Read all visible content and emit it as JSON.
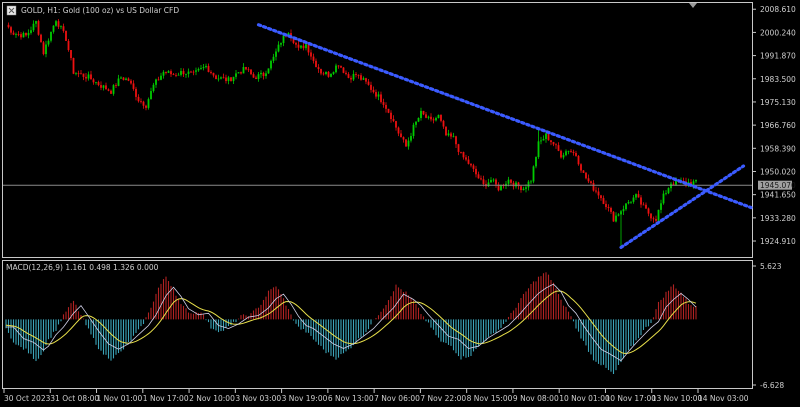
{
  "chart_data": {
    "type": "candlestick",
    "title": "GOLD, H1:  Gold (100 oz) vs US Dollar CFD",
    "price_axis": {
      "ticks": [
        "2008.610",
        "2000.240",
        "1991.870",
        "1983.500",
        "1975.130",
        "1966.760",
        "1958.390",
        "1950.020",
        "1941.650",
        "1933.280",
        "1924.910"
      ],
      "tick_values": [
        2008.61,
        2000.24,
        1991.87,
        1983.5,
        1975.13,
        1966.76,
        1958.39,
        1950.02,
        1941.65,
        1933.28,
        1924.91
      ],
      "range": [
        1919.5,
        2010.5
      ]
    },
    "current_price": {
      "label": "1945.070",
      "value": 1945.07
    },
    "time_labels": [
      "30 Oct 2023",
      "31 Oct 08:00",
      "1 Nov 01:00",
      "1 Nov 17:00",
      "2 Nov 10:00",
      "3 Nov 03:00",
      "3 Nov 19:00",
      "6 Nov 13:00",
      "7 Nov 06:00",
      "7 Nov 22:00",
      "8 Nov 15:00",
      "9 Nov 08:00",
      "10 Nov 01:00",
      "10 Nov 17:00",
      "13 Nov 10:00",
      "14 Nov 03:00"
    ],
    "close_anchors": [
      [
        0,
        2003
      ],
      [
        3,
        2000
      ],
      [
        8,
        1999
      ],
      [
        12,
        2004
      ],
      [
        15,
        1993
      ],
      [
        17,
        1998
      ],
      [
        20,
        2005
      ],
      [
        24,
        1998
      ],
      [
        27,
        1986
      ],
      [
        33,
        1984
      ],
      [
        38,
        1981
      ],
      [
        42,
        1979
      ],
      [
        46,
        1984
      ],
      [
        49,
        1983
      ],
      [
        53,
        1976
      ],
      [
        56,
        1974
      ],
      [
        59,
        1981
      ],
      [
        63,
        1986
      ],
      [
        67,
        1985
      ],
      [
        71,
        1986
      ],
      [
        75,
        1985
      ],
      [
        80,
        1988
      ],
      [
        84,
        1984
      ],
      [
        89,
        1983
      ],
      [
        93,
        1986
      ],
      [
        96,
        1987
      ],
      [
        99,
        1984
      ],
      [
        103,
        1985
      ],
      [
        107,
        1991
      ],
      [
        110,
        1997
      ],
      [
        113,
        2001
      ],
      [
        117,
        1994
      ],
      [
        120,
        1996
      ],
      [
        123,
        1990
      ],
      [
        126,
        1986
      ],
      [
        129,
        1985
      ],
      [
        133,
        1989
      ],
      [
        137,
        1984
      ],
      [
        140,
        1985
      ],
      [
        144,
        1982
      ],
      [
        147,
        1979
      ],
      [
        151,
        1975
      ],
      [
        154,
        1970
      ],
      [
        157,
        1964
      ],
      [
        160,
        1959
      ],
      [
        163,
        1966
      ],
      [
        166,
        1971
      ],
      [
        170,
        1968
      ],
      [
        173,
        1970
      ],
      [
        176,
        1963
      ],
      [
        179,
        1962
      ],
      [
        182,
        1956
      ],
      [
        185,
        1953
      ],
      [
        188,
        1949
      ],
      [
        191,
        1945
      ],
      [
        194,
        1947
      ],
      [
        197,
        1944
      ],
      [
        201,
        1947
      ],
      [
        204,
        1945
      ],
      [
        207,
        1944
      ],
      [
        210,
        1947
      ],
      [
        213,
        1960
      ],
      [
        216,
        1963
      ],
      [
        219,
        1960
      ],
      [
        222,
        1956
      ],
      [
        225,
        1958
      ],
      [
        228,
        1956
      ],
      [
        231,
        1949
      ],
      [
        234,
        1945
      ],
      [
        237,
        1942
      ],
      [
        240,
        1938
      ],
      [
        243,
        1933
      ],
      [
        246,
        1936
      ],
      [
        249,
        1939
      ],
      [
        252,
        1941
      ],
      [
        255,
        1937
      ],
      [
        258,
        1934
      ],
      [
        260,
        1933
      ],
      [
        263,
        1941
      ],
      [
        266,
        1946
      ],
      [
        269,
        1946
      ],
      [
        272,
        1946
      ],
      [
        276,
        1946
      ]
    ],
    "special_candles": [
      {
        "bar": 213,
        "kind": "spike_high",
        "high": 1966
      },
      {
        "bar": 246,
        "kind": "spike_low",
        "low": 1922.8
      }
    ],
    "trendlines": [
      {
        "name": "resistance",
        "style": "dotted",
        "color": "#3b5bff",
        "from": {
          "bar": 101,
          "price": 2003
        },
        "to": {
          "bar": 298,
          "price": 1937
        }
      },
      {
        "name": "support",
        "style": "dotted",
        "color": "#3b5bff",
        "from": {
          "bar": 246,
          "price": 1922.6
        },
        "to": {
          "bar": 295,
          "price": 1952
        }
      }
    ],
    "bull_color": "#00cc00",
    "bear_color": "#ee1111",
    "indicator": {
      "name": "MACD",
      "label": "MACD(12,26,9) 1.161 0.498 1.326 0.000",
      "ticks": [
        "5.623",
        "-6.628"
      ],
      "tick_values": [
        5.623,
        -6.628
      ],
      "histogram_up_color": "#b22222",
      "histogram_down_color": "#3ba3b8",
      "signal_color": "#e8e04a",
      "macd_line_color": "#d0d0e8",
      "hist_anchors": [
        [
          0,
          -1
        ],
        [
          4,
          -2.5
        ],
        [
          8,
          -3
        ],
        [
          12,
          -4
        ],
        [
          14,
          -3.5
        ],
        [
          17,
          -2
        ],
        [
          20,
          -1
        ],
        [
          24,
          0.8
        ],
        [
          27,
          1.8
        ],
        [
          30,
          0.4
        ],
        [
          34,
          -1.5
        ],
        [
          38,
          -3.2
        ],
        [
          42,
          -3.9
        ],
        [
          46,
          -3.2
        ],
        [
          50,
          -2
        ],
        [
          54,
          -0.8
        ],
        [
          57,
          0.6
        ],
        [
          61,
          3.1
        ],
        [
          64,
          4.2
        ],
        [
          67,
          3
        ],
        [
          70,
          1.4
        ],
        [
          74,
          0.6
        ],
        [
          78,
          0.8
        ],
        [
          82,
          -0.8
        ],
        [
          86,
          -1.2
        ],
        [
          90,
          -0.6
        ],
        [
          94,
          0.3
        ],
        [
          98,
          0.5
        ],
        [
          102,
          1.5
        ],
        [
          105,
          2.7
        ],
        [
          108,
          3.3
        ],
        [
          111,
          2
        ],
        [
          114,
          0.4
        ],
        [
          117,
          -0.8
        ],
        [
          120,
          -1.2
        ],
        [
          124,
          -2.2
        ],
        [
          128,
          -3.2
        ],
        [
          132,
          -3.8
        ],
        [
          136,
          -3.2
        ],
        [
          140,
          -2.2
        ],
        [
          144,
          -1.2
        ],
        [
          148,
          0.2
        ],
        [
          152,
          1.5
        ],
        [
          156,
          3.3
        ],
        [
          160,
          2.6
        ],
        [
          163,
          1.8
        ],
        [
          166,
          0.6
        ],
        [
          170,
          -0.8
        ],
        [
          174,
          -2.2
        ],
        [
          178,
          -2.6
        ],
        [
          182,
          -3.8
        ],
        [
          186,
          -3.5
        ],
        [
          190,
          -2.4
        ],
        [
          194,
          -1.6
        ],
        [
          198,
          -0.8
        ],
        [
          202,
          0.5
        ],
        [
          206,
          2
        ],
        [
          210,
          3.4
        ],
        [
          213,
          4.1
        ],
        [
          216,
          4.6
        ],
        [
          219,
          3.6
        ],
        [
          222,
          1.8
        ],
        [
          225,
          0.8
        ],
        [
          228,
          -0.8
        ],
        [
          231,
          -2.2
        ],
        [
          235,
          -3.9
        ],
        [
          239,
          -4.6
        ],
        [
          243,
          -5.4
        ],
        [
          246,
          -4.2
        ],
        [
          249,
          -3.1
        ],
        [
          252,
          -2.1
        ],
        [
          255,
          -1.1
        ],
        [
          258,
          -0.3
        ],
        [
          261,
          1.6
        ],
        [
          264,
          2.6
        ],
        [
          267,
          3.4
        ],
        [
          270,
          2.6
        ],
        [
          273,
          1.6
        ],
        [
          276,
          1.2
        ]
      ]
    }
  }
}
